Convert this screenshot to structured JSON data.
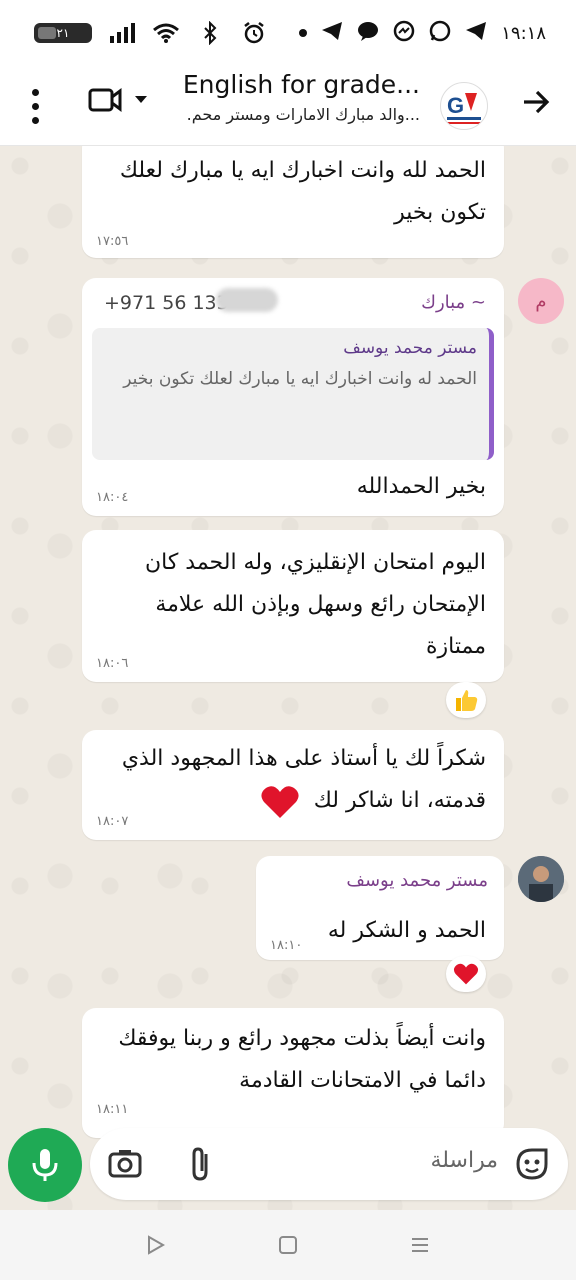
{
  "status_bar": {
    "time": "١٩:١٨",
    "battery": "٢١"
  },
  "header": {
    "title": "English for grade...",
    "subtitle": ".والد مبارك الامارات ومستر محم..."
  },
  "messages": [
    {
      "text": "الحمد لله وانت اخبارك ايه يا مبارك لعلك تكون بخير",
      "time": "١٧:٥٦"
    },
    {
      "sender": "~ مبارك",
      "phone": "+971 56 133",
      "quote_author": "مستر محمد يوسف",
      "quote_text": "الحمد له وانت اخبارك ايه يا مبارك لعلك تكون بخير",
      "text": "بخير الحمدالله",
      "time": "١٨:٠٤",
      "avatar_letter": "م"
    },
    {
      "text": "اليوم امتحان الإنقليزي، وله الحمد كان الإمتحان رائع وسهل وبإذن الله علامة ممتازة",
      "time": "١٨:٠٦"
    },
    {
      "text": "شكراً لك يا أستاذ على هذا المجهود الذي قدمته، انا شاكر لك",
      "time": "١٨:٠٧"
    },
    {
      "sender": "مستر محمد يوسف",
      "text": "الحمد و الشكر له",
      "time": "١٨:١٠"
    },
    {
      "text": "وانت أيضاً بذلت مجهود رائع و ربنا يوفقك دائما في الامتحانات القادمة",
      "time": "١٨:١١"
    }
  ],
  "input": {
    "placeholder": "مراسلة"
  },
  "colors": {
    "accent_green": "#1faa55",
    "sender_purple": "#7b3f8a",
    "chat_bg": "#efeae2"
  }
}
